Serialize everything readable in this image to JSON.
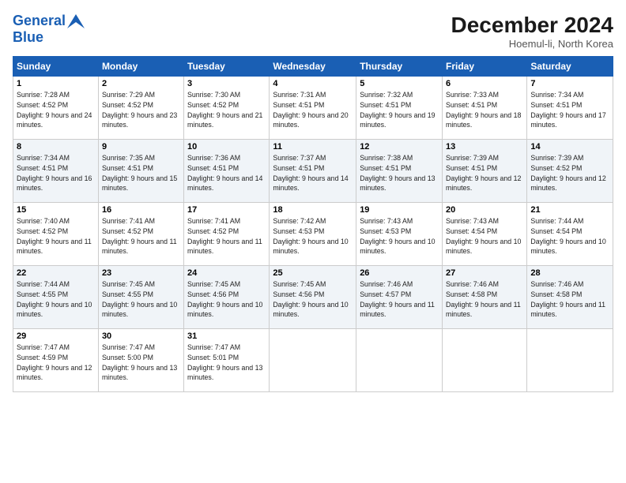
{
  "header": {
    "logo_line1": "General",
    "logo_line2": "Blue",
    "month_title": "December 2024",
    "location": "Hoemul-li, North Korea"
  },
  "weekdays": [
    "Sunday",
    "Monday",
    "Tuesday",
    "Wednesday",
    "Thursday",
    "Friday",
    "Saturday"
  ],
  "weeks": [
    [
      {
        "day": "1",
        "sunrise": "Sunrise: 7:28 AM",
        "sunset": "Sunset: 4:52 PM",
        "daylight": "Daylight: 9 hours and 24 minutes."
      },
      {
        "day": "2",
        "sunrise": "Sunrise: 7:29 AM",
        "sunset": "Sunset: 4:52 PM",
        "daylight": "Daylight: 9 hours and 23 minutes."
      },
      {
        "day": "3",
        "sunrise": "Sunrise: 7:30 AM",
        "sunset": "Sunset: 4:52 PM",
        "daylight": "Daylight: 9 hours and 21 minutes."
      },
      {
        "day": "4",
        "sunrise": "Sunrise: 7:31 AM",
        "sunset": "Sunset: 4:51 PM",
        "daylight": "Daylight: 9 hours and 20 minutes."
      },
      {
        "day": "5",
        "sunrise": "Sunrise: 7:32 AM",
        "sunset": "Sunset: 4:51 PM",
        "daylight": "Daylight: 9 hours and 19 minutes."
      },
      {
        "day": "6",
        "sunrise": "Sunrise: 7:33 AM",
        "sunset": "Sunset: 4:51 PM",
        "daylight": "Daylight: 9 hours and 18 minutes."
      },
      {
        "day": "7",
        "sunrise": "Sunrise: 7:34 AM",
        "sunset": "Sunset: 4:51 PM",
        "daylight": "Daylight: 9 hours and 17 minutes."
      }
    ],
    [
      {
        "day": "8",
        "sunrise": "Sunrise: 7:34 AM",
        "sunset": "Sunset: 4:51 PM",
        "daylight": "Daylight: 9 hours and 16 minutes."
      },
      {
        "day": "9",
        "sunrise": "Sunrise: 7:35 AM",
        "sunset": "Sunset: 4:51 PM",
        "daylight": "Daylight: 9 hours and 15 minutes."
      },
      {
        "day": "10",
        "sunrise": "Sunrise: 7:36 AM",
        "sunset": "Sunset: 4:51 PM",
        "daylight": "Daylight: 9 hours and 14 minutes."
      },
      {
        "day": "11",
        "sunrise": "Sunrise: 7:37 AM",
        "sunset": "Sunset: 4:51 PM",
        "daylight": "Daylight: 9 hours and 14 minutes."
      },
      {
        "day": "12",
        "sunrise": "Sunrise: 7:38 AM",
        "sunset": "Sunset: 4:51 PM",
        "daylight": "Daylight: 9 hours and 13 minutes."
      },
      {
        "day": "13",
        "sunrise": "Sunrise: 7:39 AM",
        "sunset": "Sunset: 4:51 PM",
        "daylight": "Daylight: 9 hours and 12 minutes."
      },
      {
        "day": "14",
        "sunrise": "Sunrise: 7:39 AM",
        "sunset": "Sunset: 4:52 PM",
        "daylight": "Daylight: 9 hours and 12 minutes."
      }
    ],
    [
      {
        "day": "15",
        "sunrise": "Sunrise: 7:40 AM",
        "sunset": "Sunset: 4:52 PM",
        "daylight": "Daylight: 9 hours and 11 minutes."
      },
      {
        "day": "16",
        "sunrise": "Sunrise: 7:41 AM",
        "sunset": "Sunset: 4:52 PM",
        "daylight": "Daylight: 9 hours and 11 minutes."
      },
      {
        "day": "17",
        "sunrise": "Sunrise: 7:41 AM",
        "sunset": "Sunset: 4:52 PM",
        "daylight": "Daylight: 9 hours and 11 minutes."
      },
      {
        "day": "18",
        "sunrise": "Sunrise: 7:42 AM",
        "sunset": "Sunset: 4:53 PM",
        "daylight": "Daylight: 9 hours and 10 minutes."
      },
      {
        "day": "19",
        "sunrise": "Sunrise: 7:43 AM",
        "sunset": "Sunset: 4:53 PM",
        "daylight": "Daylight: 9 hours and 10 minutes."
      },
      {
        "day": "20",
        "sunrise": "Sunrise: 7:43 AM",
        "sunset": "Sunset: 4:54 PM",
        "daylight": "Daylight: 9 hours and 10 minutes."
      },
      {
        "day": "21",
        "sunrise": "Sunrise: 7:44 AM",
        "sunset": "Sunset: 4:54 PM",
        "daylight": "Daylight: 9 hours and 10 minutes."
      }
    ],
    [
      {
        "day": "22",
        "sunrise": "Sunrise: 7:44 AM",
        "sunset": "Sunset: 4:55 PM",
        "daylight": "Daylight: 9 hours and 10 minutes."
      },
      {
        "day": "23",
        "sunrise": "Sunrise: 7:45 AM",
        "sunset": "Sunset: 4:55 PM",
        "daylight": "Daylight: 9 hours and 10 minutes."
      },
      {
        "day": "24",
        "sunrise": "Sunrise: 7:45 AM",
        "sunset": "Sunset: 4:56 PM",
        "daylight": "Daylight: 9 hours and 10 minutes."
      },
      {
        "day": "25",
        "sunrise": "Sunrise: 7:45 AM",
        "sunset": "Sunset: 4:56 PM",
        "daylight": "Daylight: 9 hours and 10 minutes."
      },
      {
        "day": "26",
        "sunrise": "Sunrise: 7:46 AM",
        "sunset": "Sunset: 4:57 PM",
        "daylight": "Daylight: 9 hours and 11 minutes."
      },
      {
        "day": "27",
        "sunrise": "Sunrise: 7:46 AM",
        "sunset": "Sunset: 4:58 PM",
        "daylight": "Daylight: 9 hours and 11 minutes."
      },
      {
        "day": "28",
        "sunrise": "Sunrise: 7:46 AM",
        "sunset": "Sunset: 4:58 PM",
        "daylight": "Daylight: 9 hours and 11 minutes."
      }
    ],
    [
      {
        "day": "29",
        "sunrise": "Sunrise: 7:47 AM",
        "sunset": "Sunset: 4:59 PM",
        "daylight": "Daylight: 9 hours and 12 minutes."
      },
      {
        "day": "30",
        "sunrise": "Sunrise: 7:47 AM",
        "sunset": "Sunset: 5:00 PM",
        "daylight": "Daylight: 9 hours and 13 minutes."
      },
      {
        "day": "31",
        "sunrise": "Sunrise: 7:47 AM",
        "sunset": "Sunset: 5:01 PM",
        "daylight": "Daylight: 9 hours and 13 minutes."
      },
      null,
      null,
      null,
      null
    ]
  ]
}
